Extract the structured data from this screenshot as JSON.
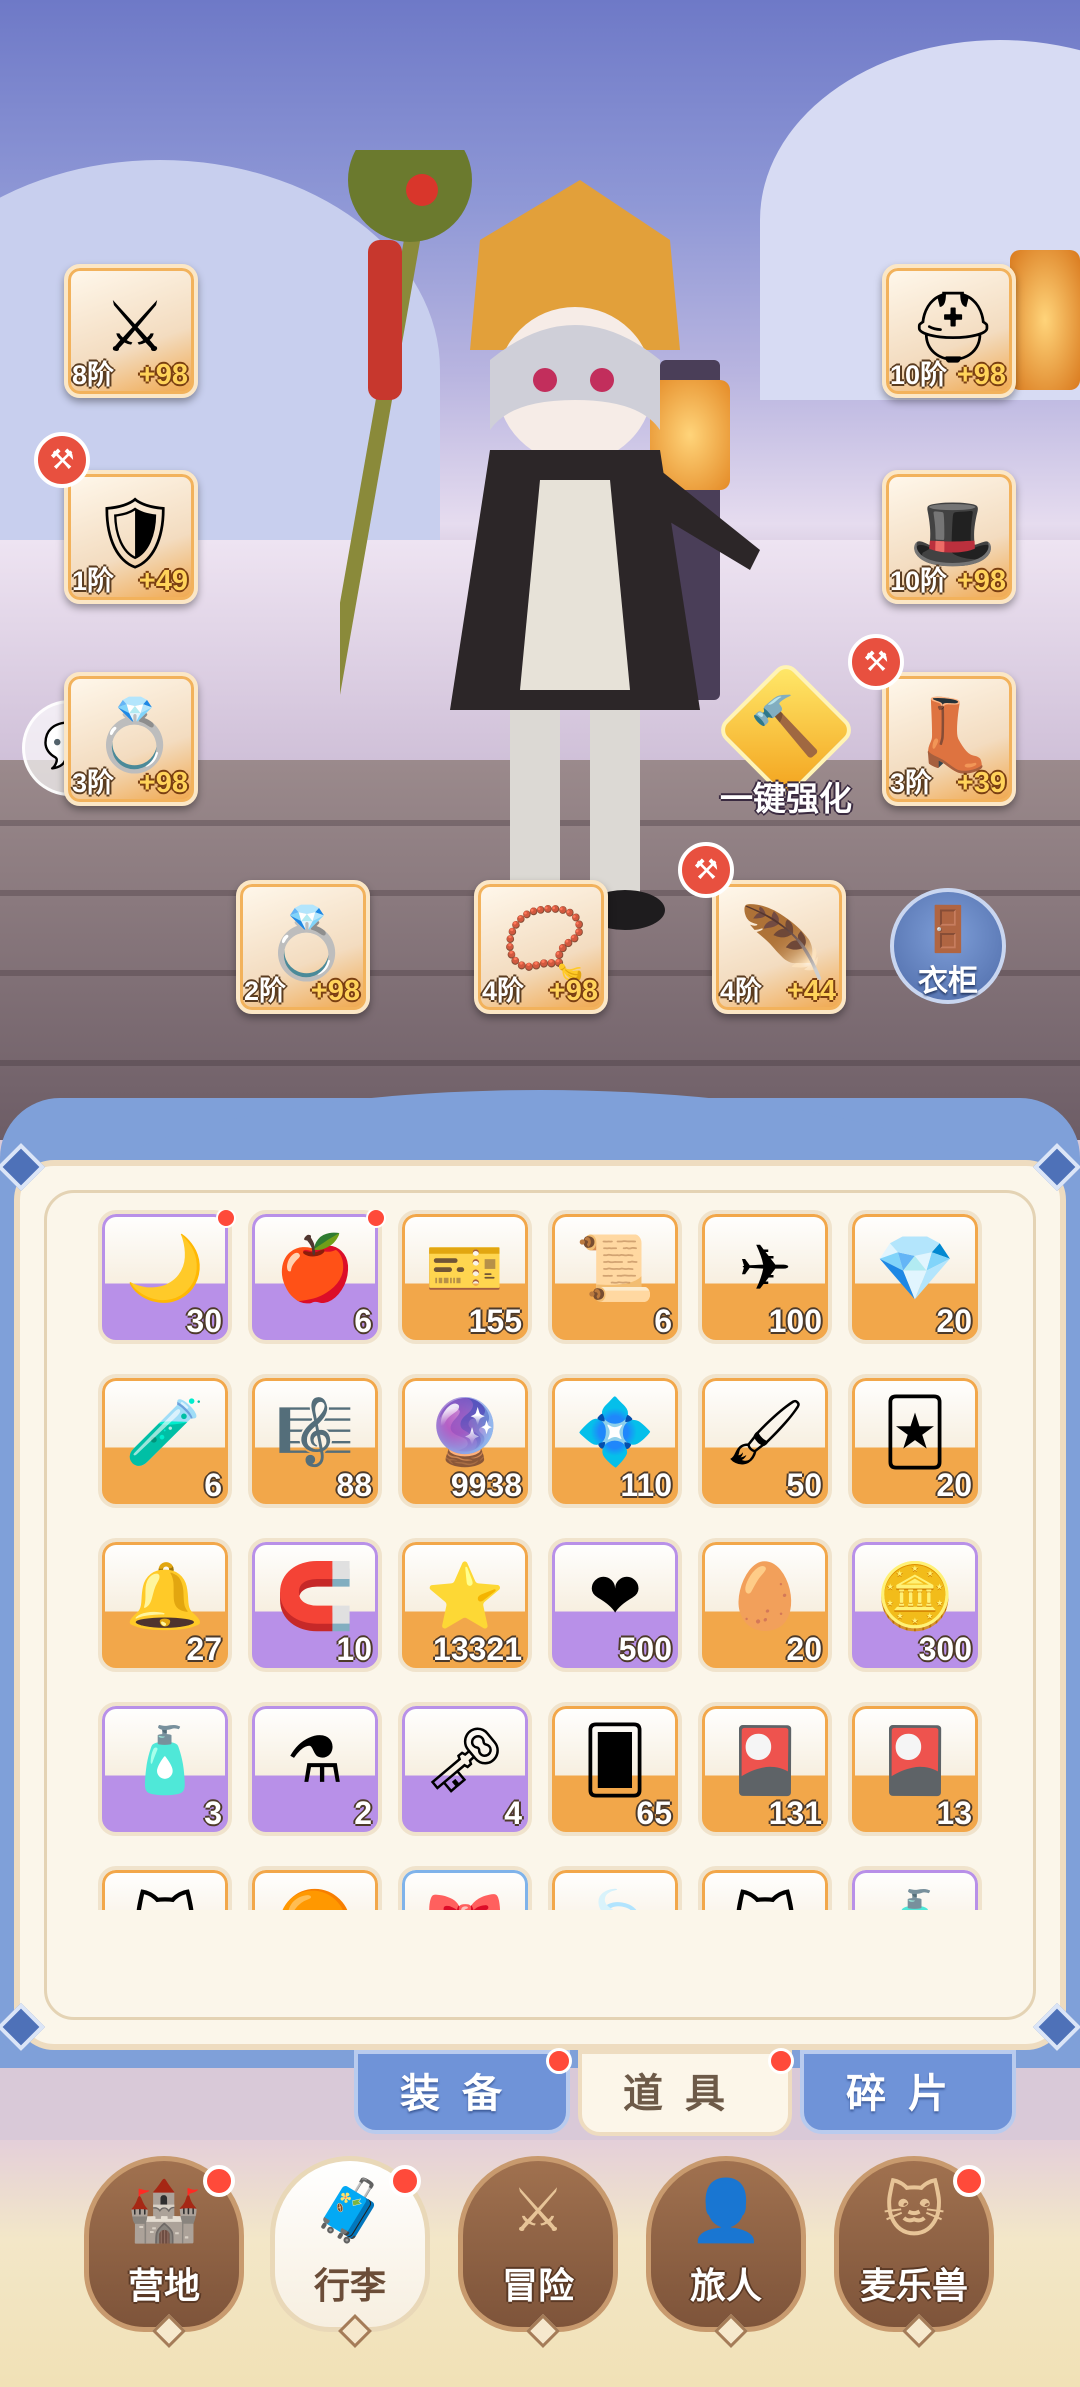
{
  "equipment": {
    "slots": [
      {
        "name": "equip-slot-weapon",
        "icon": "⚔",
        "tier": "8阶",
        "plus": "+98",
        "alert": false
      },
      {
        "name": "equip-slot-armor",
        "icon": "🛡",
        "tier": "1阶",
        "plus": "+49",
        "alert": true
      },
      {
        "name": "equip-slot-belt",
        "icon": "💍",
        "tier": "3阶",
        "plus": "+98",
        "alert": false
      },
      {
        "name": "equip-slot-helmet",
        "icon": "⛑",
        "tier": "10阶",
        "plus": "+98",
        "alert": false
      },
      {
        "name": "equip-slot-hat",
        "icon": "🎩",
        "tier": "10阶",
        "plus": "+98",
        "alert": false
      },
      {
        "name": "equip-slot-boots",
        "icon": "👢",
        "tier": "3阶",
        "plus": "+39",
        "alert": true
      },
      {
        "name": "equip-slot-ring",
        "icon": "💍",
        "tier": "2阶",
        "plus": "+98",
        "alert": false
      },
      {
        "name": "equip-slot-necklace",
        "icon": "📿",
        "tier": "4阶",
        "plus": "+98",
        "alert": false
      },
      {
        "name": "equip-slot-accessory",
        "icon": "🪶",
        "tier": "4阶",
        "plus": "+44",
        "alert": true
      }
    ],
    "enhance_label": "一键强化",
    "wardrobe_label": "衣柜"
  },
  "inventory": {
    "rows": [
      [
        {
          "icon": "🌙",
          "count": "30",
          "rarity": "purple",
          "dot": true
        },
        {
          "icon": "🍎",
          "count": "6",
          "rarity": "purple",
          "dot": true
        },
        {
          "icon": "🎫",
          "count": "155",
          "rarity": "orange",
          "dot": false
        },
        {
          "icon": "📜",
          "count": "6",
          "rarity": "orange",
          "dot": false
        },
        {
          "icon": "✈",
          "count": "100",
          "rarity": "orange",
          "dot": false
        },
        {
          "icon": "💎",
          "count": "20",
          "rarity": "orange",
          "dot": false
        }
      ],
      [
        {
          "icon": "🧪",
          "count": "6",
          "rarity": "orange",
          "dot": false
        },
        {
          "icon": "🎼",
          "count": "88",
          "rarity": "orange",
          "dot": false
        },
        {
          "icon": "🔮",
          "count": "9938",
          "rarity": "orange",
          "dot": false
        },
        {
          "icon": "💠",
          "count": "110",
          "rarity": "orange",
          "dot": false
        },
        {
          "icon": "🖌",
          "count": "50",
          "rarity": "orange",
          "dot": false
        },
        {
          "icon": "🃏",
          "count": "20",
          "rarity": "orange",
          "dot": false
        }
      ],
      [
        {
          "icon": "🔔",
          "count": "27",
          "rarity": "orange",
          "dot": false
        },
        {
          "icon": "🧲",
          "count": "10",
          "rarity": "purple",
          "dot": false
        },
        {
          "icon": "⭐",
          "count": "13321",
          "rarity": "orange",
          "dot": false
        },
        {
          "icon": "❤",
          "count": "500",
          "rarity": "purple",
          "dot": false
        },
        {
          "icon": "🥚",
          "count": "20",
          "rarity": "orange",
          "dot": false
        },
        {
          "icon": "🪙",
          "count": "300",
          "rarity": "purple",
          "dot": false
        }
      ],
      [
        {
          "icon": "🧴",
          "count": "3",
          "rarity": "purple",
          "dot": false
        },
        {
          "icon": "⚗",
          "count": "2",
          "rarity": "purple",
          "dot": false
        },
        {
          "icon": "🗝",
          "count": "4",
          "rarity": "purple",
          "dot": false
        },
        {
          "icon": "🂠",
          "count": "65",
          "rarity": "orange",
          "dot": false
        },
        {
          "icon": "🎴",
          "count": "131",
          "rarity": "orange",
          "dot": false
        },
        {
          "icon": "🎴",
          "count": "13",
          "rarity": "orange",
          "dot": false
        }
      ],
      [
        {
          "icon": "🐱",
          "count": "",
          "rarity": "orange",
          "dot": false
        },
        {
          "icon": "🟠",
          "count": "",
          "rarity": "orange",
          "dot": false
        },
        {
          "icon": "🎀",
          "count": "",
          "rarity": "blue",
          "dot": false
        },
        {
          "icon": "🍃",
          "count": "",
          "rarity": "orange",
          "dot": false
        },
        {
          "icon": "🐱",
          "count": "",
          "rarity": "orange",
          "dot": false
        },
        {
          "icon": "🧴",
          "count": "",
          "rarity": "purple",
          "dot": false
        }
      ]
    ]
  },
  "tabs": [
    {
      "label": "装备",
      "active": false,
      "dot": true
    },
    {
      "label": "道具",
      "active": true,
      "dot": true
    },
    {
      "label": "碎片",
      "active": false,
      "dot": false
    }
  ],
  "nav": [
    {
      "label": "营地",
      "icon": "🏰",
      "active": false,
      "dot": true
    },
    {
      "label": "行李",
      "icon": "🧳",
      "active": true,
      "dot": true
    },
    {
      "label": "冒险",
      "icon": "⚔",
      "active": false,
      "dot": false
    },
    {
      "label": "旅人",
      "icon": "👤",
      "active": false,
      "dot": false
    },
    {
      "label": "麦乐兽",
      "icon": "🐱",
      "active": false,
      "dot": true
    }
  ],
  "colors": {
    "rarity_purple": "#b890e8",
    "rarity_orange": "#f2a74a",
    "rarity_blue": "#7fb3ea",
    "panel_frame": "#7fa0d9",
    "tab_active_bg": "#fcf6e9",
    "badge_red": "#ff4a3a"
  }
}
